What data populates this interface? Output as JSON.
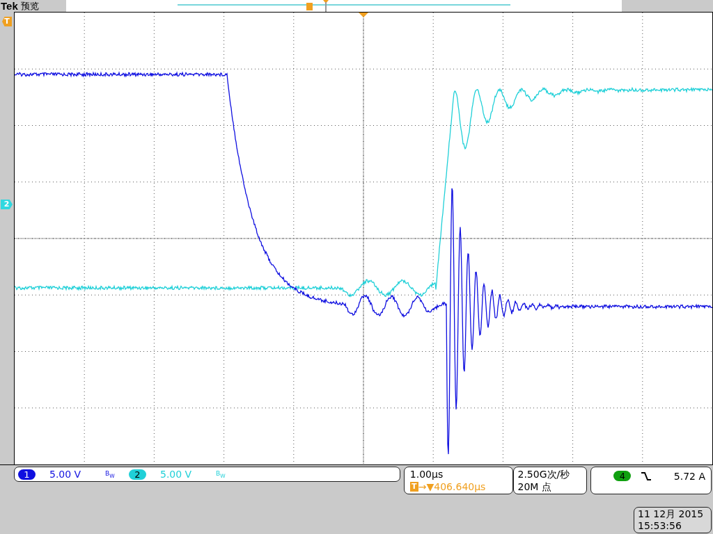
{
  "header": {
    "brand": "Tek",
    "mode": "预览"
  },
  "markers": {
    "trigger": "T",
    "channel": "2"
  },
  "channels": [
    {
      "number": "1",
      "scale": "5.00 V",
      "bandwidth": "B$_{W}$",
      "color": "#1010e0"
    },
    {
      "number": "2",
      "scale": "5.00 V",
      "bandwidth": "B$_{W}$",
      "color": "#20d0d8"
    }
  ],
  "timebase": {
    "scale": "1.00µs",
    "trigger_badge": "T",
    "arrow": "→▼",
    "position": "406.640µs"
  },
  "acquisition": {
    "sample_rate": "2.50G次/秒",
    "record_length": "20M 点"
  },
  "trigger": {
    "source": "4",
    "color": "#10a010",
    "level": "5.72 A"
  },
  "clock": {
    "date": "11 12月 2015",
    "time": "15:53:56"
  }
}
